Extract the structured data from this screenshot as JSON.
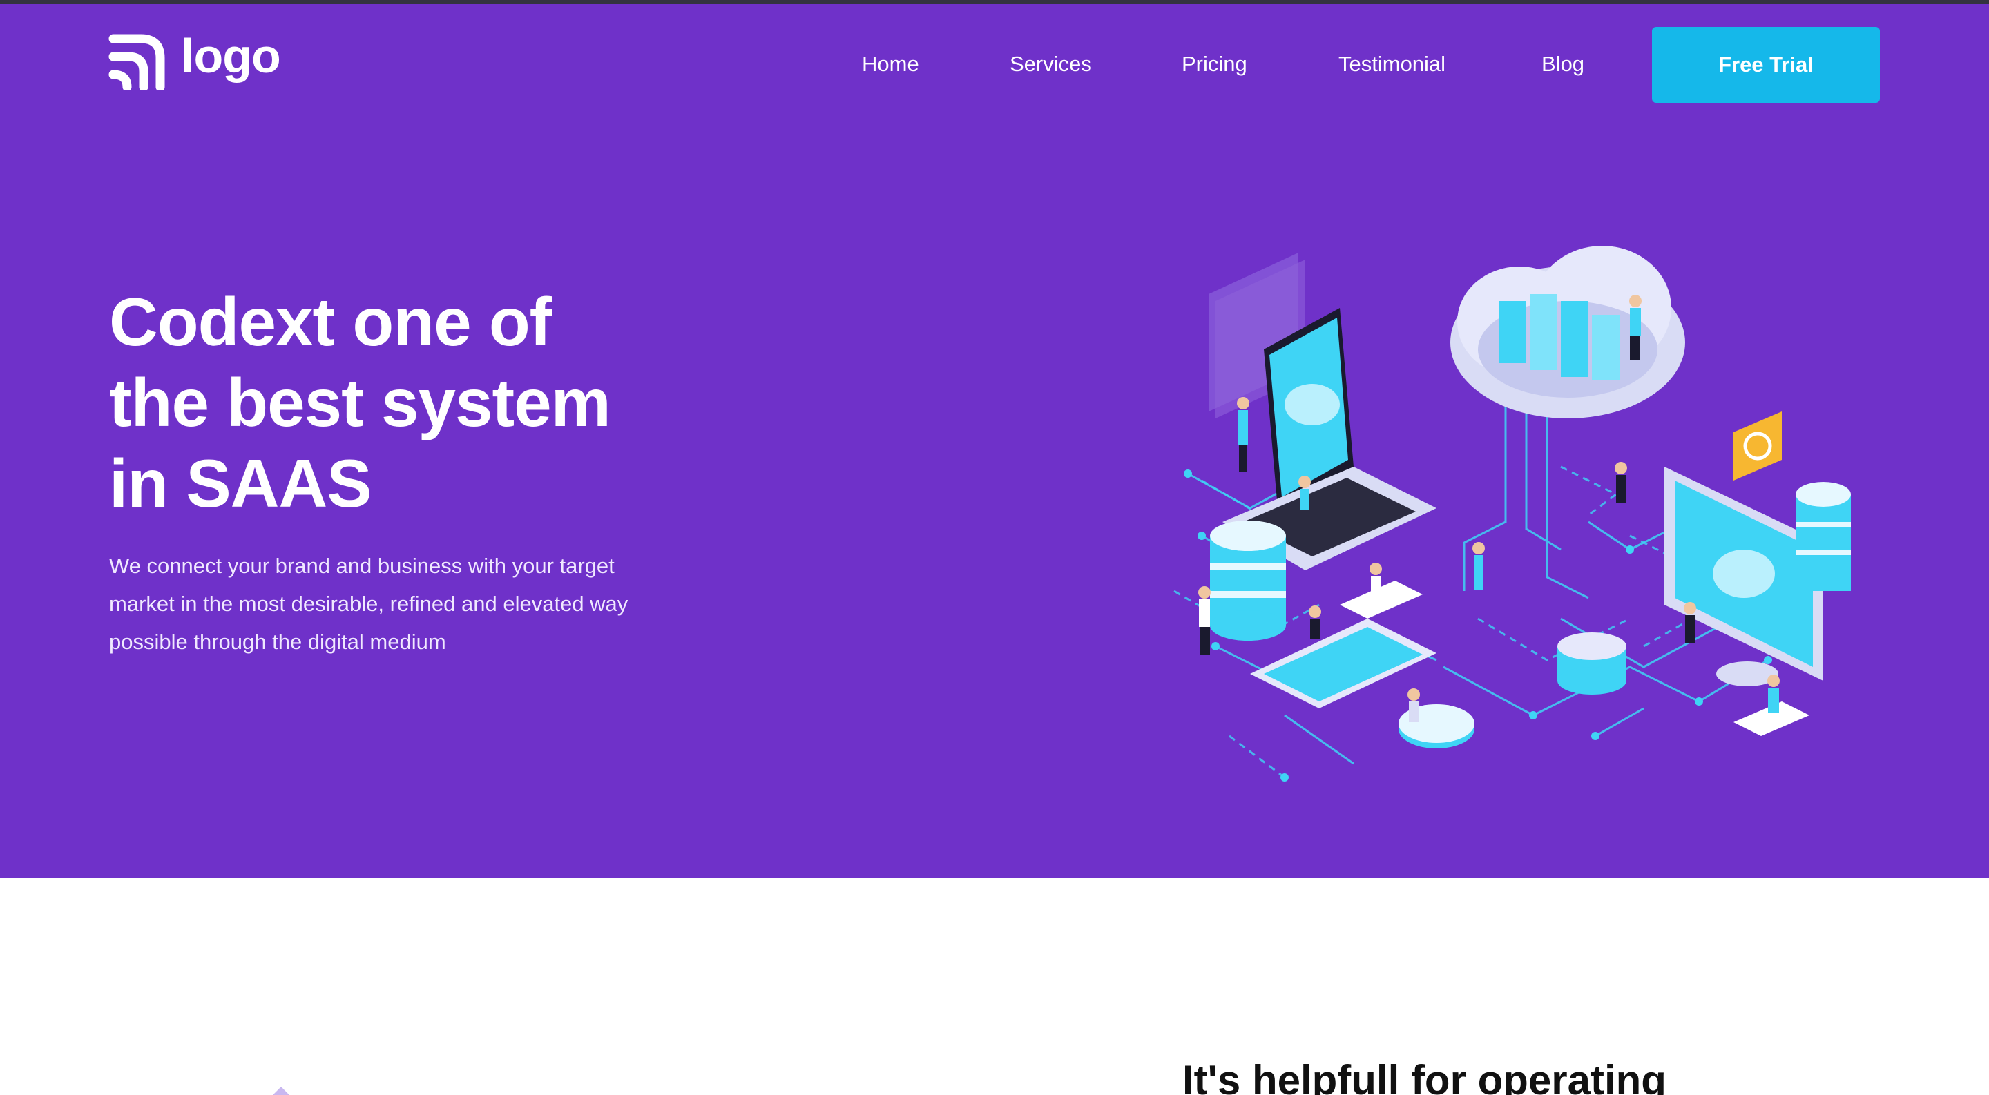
{
  "brand": {
    "logo_text": "logo"
  },
  "nav": {
    "items": [
      {
        "label": "Home"
      },
      {
        "label": "Services"
      },
      {
        "label": "Pricing"
      },
      {
        "label": "Testimonial"
      },
      {
        "label": "Blog"
      }
    ],
    "cta_label": "Free Trial"
  },
  "hero": {
    "title_lines": [
      "Codext one of",
      "the best system",
      "in SAAS"
    ],
    "subtitle_lines": [
      "We connect your brand and business with your target",
      "market in the most desirable, refined and elevated way",
      "possible through the digital medium"
    ]
  },
  "next_section": {
    "heading": "It's helpfull for operating"
  },
  "colors": {
    "hero_bg": "#6f31c9",
    "cta_bg": "#15b8ea",
    "illustration_cyan": "#3fd4f5",
    "illustration_lavender": "#d9dcf5"
  },
  "icons": {
    "logo": "wifi-arcs-logo-icon"
  }
}
